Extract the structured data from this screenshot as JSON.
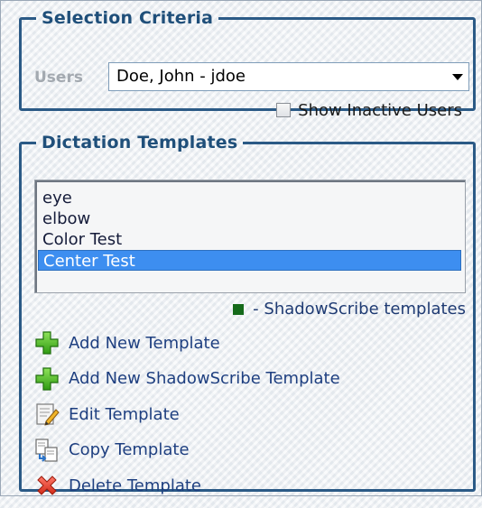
{
  "selection_criteria": {
    "title": "Selection Criteria",
    "users_label": "Users",
    "users_selected": "Doe, John - jdoe",
    "show_inactive_label": "Show Inactive Users",
    "show_inactive_checked": false
  },
  "dictation_templates": {
    "title": "Dictation Templates",
    "items": [
      {
        "label": "eye",
        "selected": false
      },
      {
        "label": "elbow",
        "selected": false
      },
      {
        "label": "Color Test",
        "selected": false
      },
      {
        "label": "Center Test",
        "selected": true
      }
    ],
    "legend_label": "- ShadowScribe templates",
    "legend_color": "#156a1a",
    "actions": [
      {
        "label": "Add New Template",
        "icon": "green-plus-icon"
      },
      {
        "label": "Add New ShadowScribe Template",
        "icon": "green-plus-icon"
      },
      {
        "label": "Edit Template",
        "icon": "edit-pencil-icon"
      },
      {
        "label": "Copy Template",
        "icon": "copy-documents-icon"
      },
      {
        "label": "Delete Template",
        "icon": "red-x-icon"
      }
    ]
  },
  "colors": {
    "panel_border": "#2b5a86",
    "selection_highlight": "#3d8ef0",
    "link_text": "#1e3f80"
  }
}
